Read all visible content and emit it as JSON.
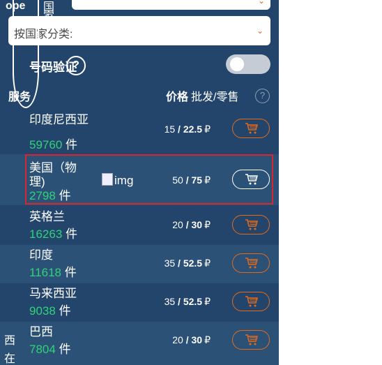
{
  "filters": {
    "top_select_arrow": "chevron-down-icon",
    "country_placeholder": "按国家分类:"
  },
  "verify": {
    "label": "号码验证",
    "help": "?",
    "enabled": false
  },
  "price_header": {
    "bold": "价格",
    "rest": "批发/零售",
    "help": "?"
  },
  "rows": [
    {
      "name": "印度尼西亚",
      "count": "59760",
      "unit": "件",
      "wholesale": "15",
      "retail": "22.5",
      "currency": "₽"
    },
    {
      "name": "美国（物理)",
      "count": "2798",
      "unit": "件",
      "wholesale": "50",
      "retail": "75",
      "currency": "₽",
      "image_alt": "img"
    },
    {
      "name": "英格兰",
      "count": "16263",
      "unit": "件",
      "wholesale": "20",
      "retail": "30",
      "currency": "₽"
    },
    {
      "name": "印度",
      "count": "11618",
      "unit": "件",
      "wholesale": "35",
      "retail": "52.5",
      "currency": "₽"
    },
    {
      "name": "马来西亚",
      "count": "9038",
      "unit": "件",
      "wholesale": "35",
      "retail": "52.5",
      "currency": "₽"
    },
    {
      "name": "巴西",
      "count": "7804",
      "unit": "件",
      "wholesale": "20",
      "retail": "30",
      "currency": "₽"
    }
  ],
  "overflow_left": {
    "l1": "ope",
    "l2": "家",
    "l3": "服务",
    "l4": "在",
    "l5": "西",
    "l6": "国"
  },
  "colors": {
    "panel": "#24456b",
    "accent": "#e46a1b",
    "count": "#2fd27a",
    "selected": "#d8252e"
  }
}
